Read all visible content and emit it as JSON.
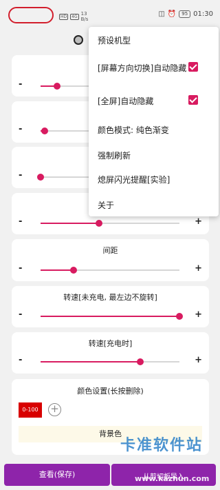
{
  "status_bar": {
    "network": "HD",
    "signal": "4G",
    "speed_value": "13",
    "speed_unit": "B/s",
    "battery": "95",
    "time": "01:30"
  },
  "sliders": [
    {
      "title": "",
      "value": 0.12,
      "has_plus": false
    },
    {
      "title": "",
      "value": 0.03,
      "has_plus": false
    },
    {
      "title": "",
      "value": 0.0,
      "has_plus": false
    },
    {
      "title": "",
      "value": 0.42,
      "has_plus": true
    },
    {
      "title": "间距",
      "value": 0.24,
      "has_plus": true
    },
    {
      "title": "转速[未充电, 最左边不旋转]",
      "value": 1.0,
      "has_plus": true
    },
    {
      "title": "转速[充电时]",
      "value": 0.72,
      "has_plus": true
    }
  ],
  "controls": {
    "minus": "-",
    "plus": "+"
  },
  "color_settings": {
    "title": "颜色设置(长按删除)",
    "swatch_label": "0-100",
    "swatch_color": "#d80000",
    "add_symbol": "+",
    "background_label": "背景色"
  },
  "bottom_buttons": {
    "save": "查看(保存)",
    "import": "从剪切板导入"
  },
  "menu": {
    "items": [
      {
        "label": "预设机型",
        "checked": false
      },
      {
        "label": "[屏幕方向切换]自动隐藏",
        "checked": true
      },
      {
        "label": "[全屏]自动隐藏",
        "checked": true
      },
      {
        "label": "颜色模式: 纯色渐变",
        "checked": false
      },
      {
        "label": "强制刷新",
        "checked": false
      },
      {
        "label": "熄屏闪光提醒[实验]",
        "checked": false
      },
      {
        "label": "关于",
        "checked": false
      }
    ]
  },
  "watermark": {
    "text": "卡准软件站",
    "url": "www.kazhun.com"
  },
  "colors": {
    "accent": "#d81b60",
    "button": "#8e24aa",
    "background": "#f1f1f1"
  }
}
